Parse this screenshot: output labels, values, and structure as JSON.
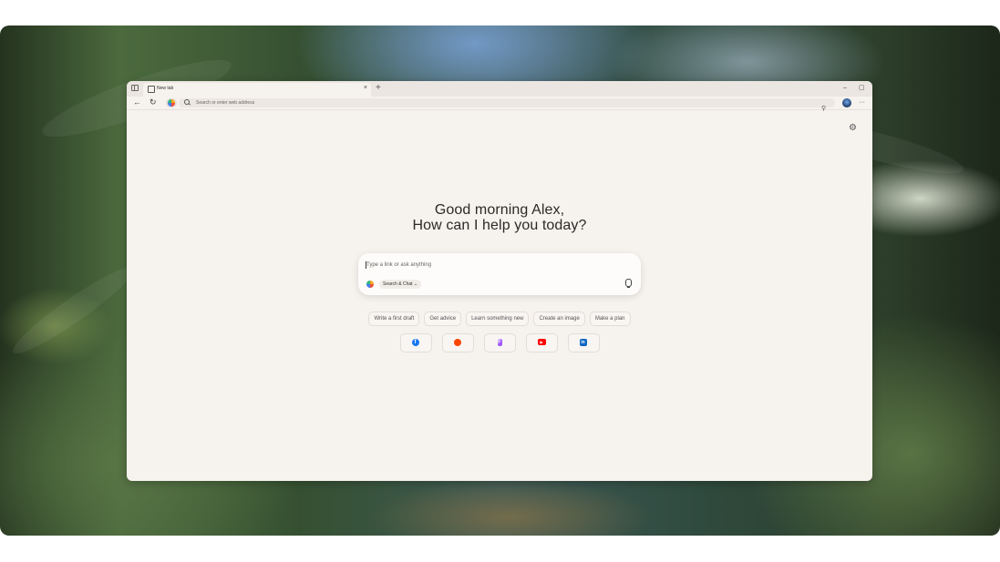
{
  "browser": {
    "tab": {
      "title": "New tab",
      "close_glyph": "×"
    },
    "new_tab_glyph": "+",
    "window_controls": {
      "minimize": "–",
      "restore": "▢"
    },
    "nav": {
      "back": "←",
      "refresh": "↻"
    },
    "address_placeholder": "Search or enter web address",
    "more_glyph": "···"
  },
  "ntp": {
    "greeting_line1": "Good morning Alex,",
    "greeting_line2": "How can I help you today?",
    "composer": {
      "placeholder": "Type a link or ask anything",
      "mode_label": "Search & Chat",
      "mode_chevron": "⌄"
    },
    "suggestions": [
      "Write a first draft",
      "Get advice",
      "Learn something new",
      "Create an image",
      "Make a plan"
    ],
    "shortcuts": [
      {
        "name": "facebook-icon",
        "glyph": "f",
        "color": "#1877f2"
      },
      {
        "name": "reddit-icon",
        "glyph": "●",
        "color": "#ff4500"
      },
      {
        "name": "figma-icon",
        "glyph": "F",
        "color": "#a259ff"
      },
      {
        "name": "youtube-icon",
        "glyph": "▶",
        "color": "#ff0000"
      },
      {
        "name": "linkedin-icon",
        "glyph": "in",
        "color": "#0a66c2"
      }
    ],
    "settings_glyph": "⚙"
  },
  "colors": {
    "page_bg": "#f6f2ee",
    "tab_strip": "#ebe6e1"
  }
}
